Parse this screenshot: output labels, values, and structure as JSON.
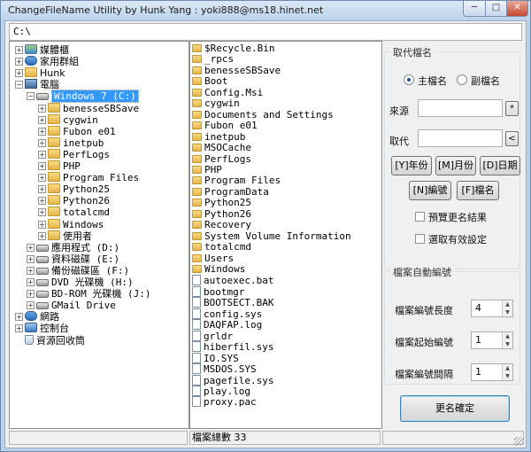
{
  "window": {
    "title": "ChangeFileName Utility by Hunk Yang : yoki888@ms18.hinet.net",
    "min": "─",
    "max": "□",
    "close": "✕"
  },
  "path": "C:\\",
  "tree": [
    {
      "label": "媒體櫃",
      "icon": "library-icon"
    },
    {
      "label": "家用群組",
      "icon": "homegroup-icon"
    },
    {
      "label": "Hunk",
      "icon": "user-folder-icon"
    },
    {
      "label": "電腦",
      "icon": "computer-icon"
    },
    {
      "label": "Windows 7 (C:)",
      "icon": "drive-icon"
    },
    {
      "label": "benesseSBSave",
      "icon": "folder-icon"
    },
    {
      "label": "cygwin",
      "icon": "folder-icon"
    },
    {
      "label": "Fubon e01",
      "icon": "folder-icon"
    },
    {
      "label": "inetpub",
      "icon": "folder-icon"
    },
    {
      "label": "PerfLogs",
      "icon": "folder-icon"
    },
    {
      "label": "PHP",
      "icon": "folder-icon"
    },
    {
      "label": "Program Files",
      "icon": "folder-icon"
    },
    {
      "label": "Python25",
      "icon": "folder-icon"
    },
    {
      "label": "Python26",
      "icon": "folder-icon"
    },
    {
      "label": "totalcmd",
      "icon": "folder-icon"
    },
    {
      "label": "Windows",
      "icon": "folder-icon"
    },
    {
      "label": "使用者",
      "icon": "folder-icon"
    },
    {
      "label": "應用程式 (D:)",
      "icon": "drive-icon"
    },
    {
      "label": "資料磁碟 (E:)",
      "icon": "drive-icon"
    },
    {
      "label": "備份磁碟區 (F:)",
      "icon": "drive-icon"
    },
    {
      "label": "DVD 光碟機 (H:)",
      "icon": "dvd-drive-icon"
    },
    {
      "label": "BD-ROM 光碟機 (J:)",
      "icon": "bd-drive-icon"
    },
    {
      "label": "GMail Drive",
      "icon": "drive-icon"
    },
    {
      "label": "網路",
      "icon": "network-icon"
    },
    {
      "label": "控制台",
      "icon": "control-panel-icon"
    },
    {
      "label": "資源回收筒",
      "icon": "recycle-bin-icon"
    }
  ],
  "files": [
    {
      "name": "$Recycle.Bin",
      "type": "folder"
    },
    {
      "name": "_rpcs",
      "type": "folder"
    },
    {
      "name": "benesseSBSave",
      "type": "folder"
    },
    {
      "name": "Boot",
      "type": "folder"
    },
    {
      "name": "Config.Msi",
      "type": "folder"
    },
    {
      "name": "cygwin",
      "type": "folder"
    },
    {
      "name": "Documents and Settings",
      "type": "folder"
    },
    {
      "name": "Fubon e01",
      "type": "folder"
    },
    {
      "name": "inetpub",
      "type": "folder"
    },
    {
      "name": "MSOCache",
      "type": "folder"
    },
    {
      "name": "PerfLogs",
      "type": "folder"
    },
    {
      "name": "PHP",
      "type": "folder"
    },
    {
      "name": "Program Files",
      "type": "folder"
    },
    {
      "name": "ProgramData",
      "type": "folder"
    },
    {
      "name": "Python25",
      "type": "folder"
    },
    {
      "name": "Python26",
      "type": "folder"
    },
    {
      "name": "Recovery",
      "type": "folder"
    },
    {
      "name": "System Volume Information",
      "type": "folder"
    },
    {
      "name": "totalcmd",
      "type": "folder"
    },
    {
      "name": "Users",
      "type": "folder"
    },
    {
      "name": "Windows",
      "type": "folder"
    },
    {
      "name": "autoexec.bat",
      "type": "file"
    },
    {
      "name": "bootmgr",
      "type": "file"
    },
    {
      "name": "BOOTSECT.BAK",
      "type": "file"
    },
    {
      "name": "config.sys",
      "type": "file"
    },
    {
      "name": "DAQFAP.log",
      "type": "file"
    },
    {
      "name": "grldr",
      "type": "file"
    },
    {
      "name": "hiberfil.sys",
      "type": "file"
    },
    {
      "name": "IO.SYS",
      "type": "file"
    },
    {
      "name": "MSDOS.SYS",
      "type": "file"
    },
    {
      "name": "pagefile.sys",
      "type": "file"
    },
    {
      "name": "play.log",
      "type": "file"
    },
    {
      "name": "proxy.pac",
      "type": "file"
    }
  ],
  "replace_group": {
    "title": "取代檔名",
    "radio_main": "主檔名",
    "radio_ext": "副檔名",
    "source_label": "來源",
    "source_btn": "*",
    "replace_label": "取代",
    "replace_btn": "<",
    "btn_year": "[Y]年份",
    "btn_month": "[M]月份",
    "btn_day": "[D]日期",
    "btn_num": "[N]編號",
    "btn_filename": "[F]檔名",
    "chk_preview": "預覽更名結果",
    "chk_valid": "選取有效設定"
  },
  "autonum_group": {
    "title": "檔案自動編號",
    "len_label": "檔案編號長度",
    "len_value": "4",
    "start_label": "檔案起始編號",
    "start_value": "1",
    "step_label": "檔案編號間隔",
    "step_value": "1"
  },
  "confirm_btn": "更名確定",
  "status": {
    "file_count": "檔案總數 33"
  }
}
